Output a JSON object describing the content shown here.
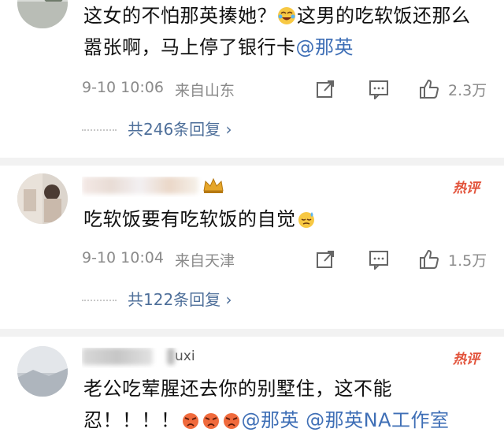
{
  "comments": [
    {
      "text_parts": [
        "这女的不怕那英揍她？",
        "这男的吃软饭还那么嚣张啊，马上停了银行卡",
        "@那英"
      ],
      "time": "9-10 10:06",
      "source": "来自山东",
      "likes": "2.3万",
      "replies": "共246条回复 ›",
      "emoji_icon": "laughing-crying-emoji"
    },
    {
      "username_suffix": "",
      "hot_label": "热评",
      "text": "吃软饭要有吃软饭的自觉",
      "emoji_icon": "sweat-emoji",
      "time": "9-10 10:04",
      "source": "来自天津",
      "likes": "1.5万",
      "replies": "共122条回复 ›"
    },
    {
      "username_suffix": "uxi",
      "hot_label": "热评",
      "text": "老公吃荤腥还去你的别墅住，这不能忍！！！！",
      "mentions": [
        "@那英",
        "@那英NA工作室"
      ],
      "emoji_icon": "angry-face-emoji"
    }
  ],
  "colors": {
    "mention": "#3f6fb6",
    "hot": "#e2523a",
    "meta": "#8a8a8a",
    "divider": "#f2f2f2"
  }
}
